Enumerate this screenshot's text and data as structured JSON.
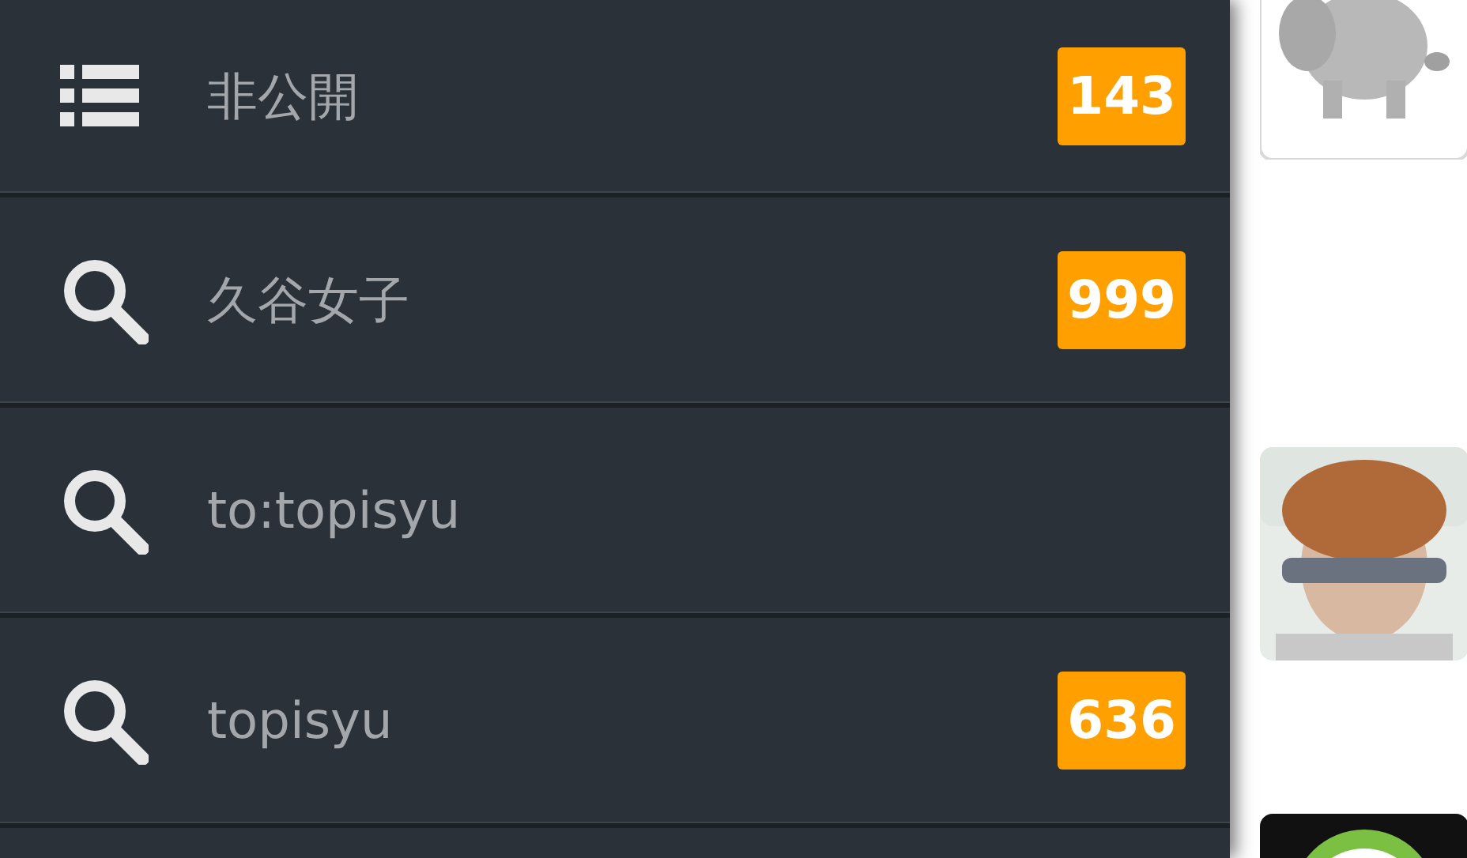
{
  "drawer": {
    "items": [
      {
        "kind": "list",
        "label": "非公開",
        "badge": "143"
      },
      {
        "kind": "search",
        "label": "久谷女子",
        "badge": "999"
      },
      {
        "kind": "search",
        "label": "to:topisyu"
      },
      {
        "kind": "search",
        "label": "topisyu",
        "badge": "636"
      }
    ]
  }
}
